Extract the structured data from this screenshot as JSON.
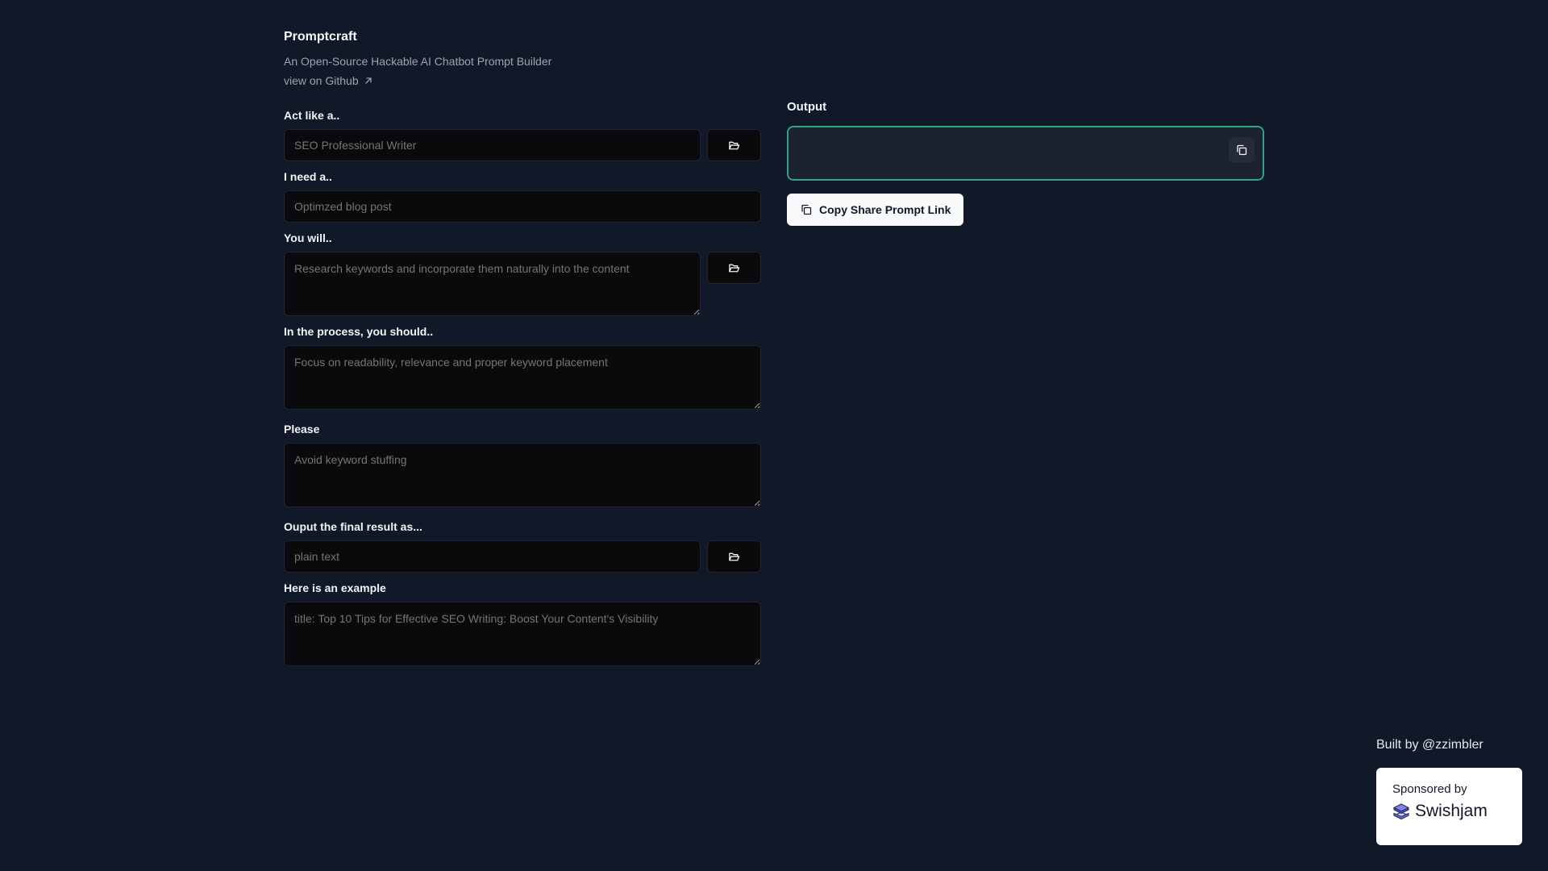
{
  "header": {
    "title": "Promptcraft",
    "subtitle": "An Open-Source Hackable AI Chatbot Prompt Builder",
    "github_link": "view on Github",
    "github_icon": "arrow-up-right-icon"
  },
  "form": {
    "act_like": {
      "label": "Act like a..",
      "placeholder": "SEO Professional Writer",
      "value": "",
      "has_template_button": true,
      "template_icon": "folder-open-icon"
    },
    "i_need": {
      "label": "I need a..",
      "placeholder": "Optimzed blog post",
      "value": ""
    },
    "you_will": {
      "label": "You will..",
      "placeholder": "Research keywords and incorporate them naturally into the content",
      "value": "",
      "has_template_button": true,
      "template_icon": "folder-open-icon"
    },
    "in_process": {
      "label": "In the process, you should..",
      "placeholder": "Focus on readability, relevance and proper keyword placement",
      "value": ""
    },
    "please": {
      "label": "Please",
      "placeholder": "Avoid keyword stuffing",
      "value": ""
    },
    "output_as": {
      "label": "Ouput the final result as...",
      "placeholder": "plain text",
      "value": "",
      "has_template_button": true,
      "template_icon": "folder-open-icon"
    },
    "example": {
      "label": "Here is an example",
      "placeholder": "title: Top 10 Tips for Effective SEO Writing: Boost Your Content's Visibility",
      "value": ""
    }
  },
  "output": {
    "label": "Output",
    "value": "",
    "copy_icon": "copy-icon",
    "share_button_label": "Copy Share Prompt Link",
    "accent_color": "#2fa57f"
  },
  "footer": {
    "built_by": "Built by @zzimbler",
    "sponsored_by": "Sponsored by",
    "sponsor_name": "Swishjam",
    "sponsor_logo_icon": "stacked-layers-icon"
  },
  "colors": {
    "background": "#111827",
    "field_background": "#0a0a0c",
    "output_background": "#1d2230",
    "accent": "#2fa57f"
  }
}
